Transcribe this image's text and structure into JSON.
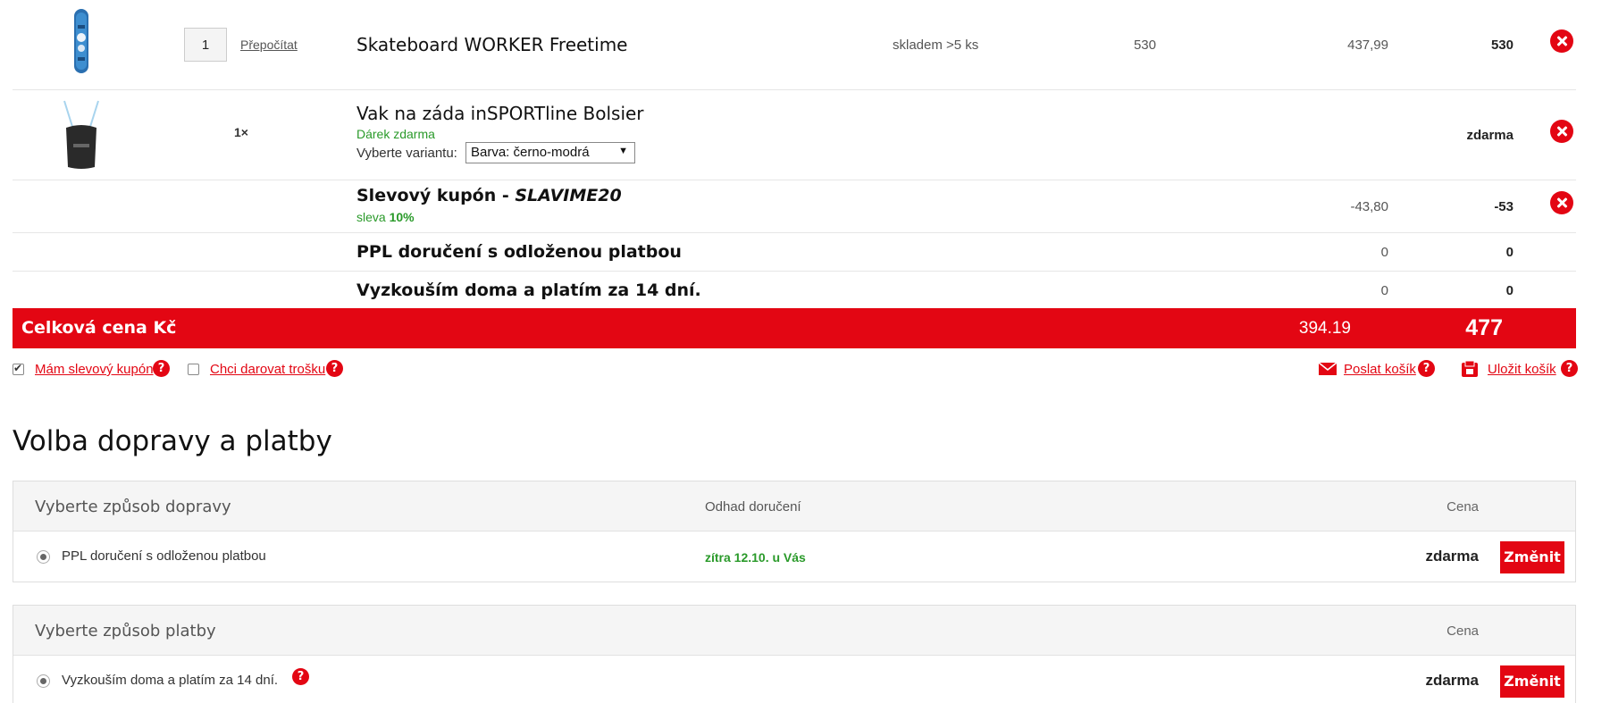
{
  "cart": {
    "items": [
      {
        "name": "Skateboard WORKER Freetime",
        "quantity": "1",
        "recalc_label": "Přepočítat",
        "stock": "skladem >5 ks",
        "unit_price": "530",
        "price_net": "437,99",
        "price_total": "530"
      },
      {
        "name": "Vak na záda inSPORTline Bolsier",
        "quantity": "1×",
        "gift_note": "Dárek zdarma",
        "variant_label": "Vyberte variantu:",
        "variant_value": "Barva: černo-modrá",
        "price_total": "zdarma"
      }
    ],
    "coupon": {
      "prefix": "Slevový kupón - ",
      "code": "SLAVIME20",
      "discount_label": "sleva ",
      "discount_value": "10%",
      "price_net": "-43,80",
      "price_total": "-53"
    },
    "shipping_line": {
      "name": "PPL doručení s odloženou platbou",
      "price_net": "0",
      "price_total": "0"
    },
    "payment_line": {
      "name": "Vyzkouším doma a platím za 14 dní.",
      "price_net": "0",
      "price_total": "0"
    },
    "total": {
      "label": "Celková cena Kč",
      "net": "394.19",
      "gross": "477"
    }
  },
  "options": {
    "coupon_checkbox": "Mám slevový kupón",
    "donate_checkbox": "Chci darovat trošku",
    "send_cart": "Poslat košík",
    "save_cart": "Uložit košík",
    "help_glyph": "?"
  },
  "section_title": "Volba dopravy a platby",
  "shipping": {
    "header": "Vyberte způsob dopravy",
    "eta_header": "Odhad doručení",
    "price_header": "Cena",
    "option": {
      "label": "PPL doručení s odloženou platbou",
      "eta": "zítra 12.10. u Vás",
      "price": "zdarma"
    },
    "change_label": "Změnit"
  },
  "payment": {
    "header": "Vyberte způsob platby",
    "price_header": "Cena",
    "option": {
      "label": "Vyzkouším doma a platím za 14 dní.",
      "price": "zdarma"
    },
    "change_label": "Změnit"
  },
  "colors": {
    "accent": "#e30613",
    "green": "#2a9a2a"
  }
}
